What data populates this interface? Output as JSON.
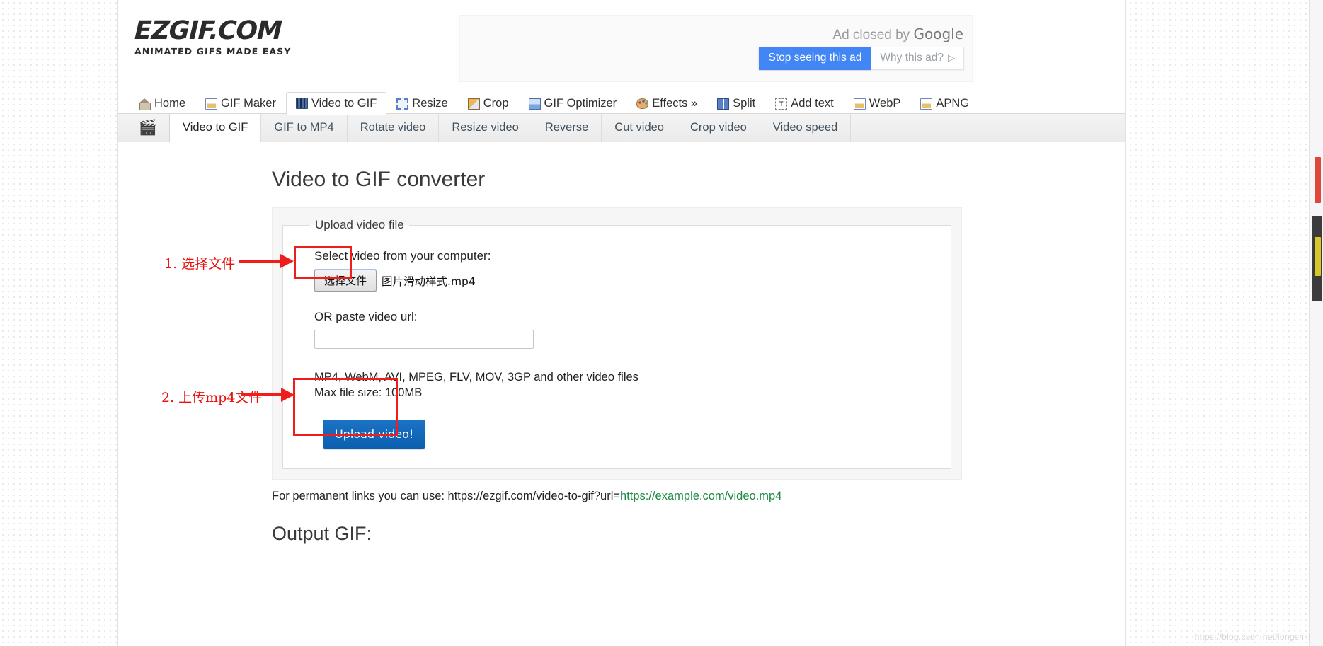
{
  "site": {
    "logo_main": "EZGIF.COM",
    "logo_sub": "ANIMATED GIFS MADE EASY"
  },
  "ad": {
    "closed_prefix": "Ad closed by ",
    "closed_brand": "Google",
    "stop_label": "Stop seeing this ad",
    "why_label": "Why this ad?",
    "why_glyph": "▷"
  },
  "mainnav": {
    "items": [
      {
        "label": "Home",
        "icon": "home-icon",
        "active": false
      },
      {
        "label": "GIF Maker",
        "icon": "gif-maker-icon",
        "active": false
      },
      {
        "label": "Video to GIF",
        "icon": "video-to-gif-icon",
        "active": true
      },
      {
        "label": "Resize",
        "icon": "resize-icon",
        "active": false
      },
      {
        "label": "Crop",
        "icon": "crop-icon",
        "active": false
      },
      {
        "label": "GIF Optimizer",
        "icon": "optimizer-icon",
        "active": false
      },
      {
        "label": "Effects »",
        "icon": "palette-icon",
        "active": false
      },
      {
        "label": "Split",
        "icon": "split-icon",
        "active": false
      },
      {
        "label": "Add text",
        "icon": "add-text-icon",
        "active": false
      },
      {
        "label": "WebP",
        "icon": "webp-icon",
        "active": false
      },
      {
        "label": "APNG",
        "icon": "apng-icon",
        "active": false
      }
    ]
  },
  "subnav": {
    "logo_glyph": "🎬",
    "items": [
      {
        "label": "Video to GIF",
        "active": true
      },
      {
        "label": "GIF to MP4",
        "active": false
      },
      {
        "label": "Rotate video",
        "active": false
      },
      {
        "label": "Resize video",
        "active": false
      },
      {
        "label": "Reverse",
        "active": false
      },
      {
        "label": "Cut video",
        "active": false
      },
      {
        "label": "Crop video",
        "active": false
      },
      {
        "label": "Video speed",
        "active": false
      }
    ]
  },
  "main": {
    "page_title": "Video to GIF converter",
    "fieldset_legend": "Upload video file",
    "select_label": "Select video from your computer:",
    "file_button_label": "选择文件",
    "file_name": "图片滑动样式.mp4",
    "url_label": "OR paste video url:",
    "url_value": "",
    "url_placeholder": "",
    "formats_line1": "MP4, WebM, AVI, MPEG, FLV, MOV, 3GP and other video files",
    "formats_line2": "Max file size: 100MB",
    "upload_button_label": "Upload video!",
    "permalink_prefix": "For permanent links you can use: https://ezgif.com/video-to-gif?url=",
    "permalink_url": "https://example.com/video.mp4",
    "output_title": "Output GIF:"
  },
  "annotations": [
    {
      "text": "1. 选择文件"
    },
    {
      "text": "2. 上传mp4文件"
    }
  ],
  "watermark": "https://blog.csdn.net/longshili",
  "colors": {
    "accent_blue": "#0b5fb0",
    "ad_blue": "#4285f4",
    "annotation_red": "#f01d1d",
    "link_green": "#1d8a43"
  }
}
